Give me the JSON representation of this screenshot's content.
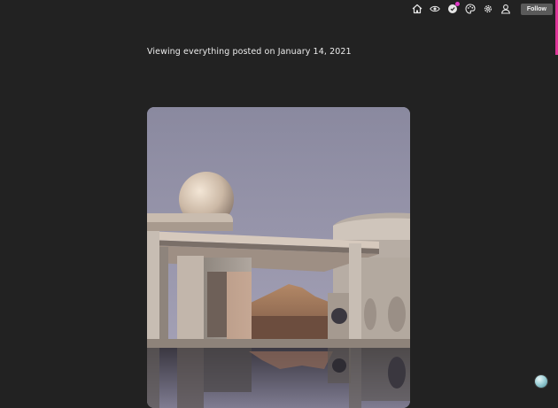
{
  "header": {
    "icons": [
      {
        "name": "home-icon"
      },
      {
        "name": "eye-icon"
      },
      {
        "name": "notification-icon",
        "has_notification": true
      },
      {
        "name": "palette-icon"
      },
      {
        "name": "gear-icon"
      },
      {
        "name": "user-icon"
      }
    ],
    "follow_label": "Follow"
  },
  "main": {
    "heading": "Viewing everything posted on January 14, 2021"
  },
  "colors": {
    "background": "#222222",
    "accent": "#e0359a",
    "notification": "#e23ac9"
  }
}
